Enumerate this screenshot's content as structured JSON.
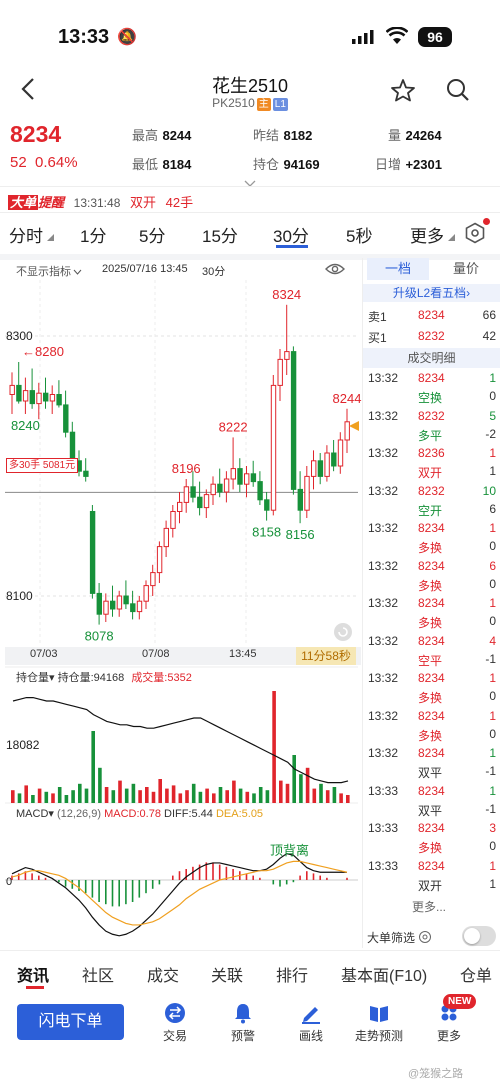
{
  "status_bar": {
    "time": "13:33",
    "battery": "96"
  },
  "header": {
    "title": "花生2510",
    "code": "PK2510",
    "tag_main": "主",
    "tag_level": "L1"
  },
  "quote": {
    "price": "8234",
    "change": "52",
    "change_pct": "0.64%",
    "high_label": "最高",
    "high": "8244",
    "low_label": "最低",
    "low": "8184",
    "prev_settle_label": "昨结",
    "prev_settle": "8182",
    "open_interest_label": "持仓",
    "open_interest": "94169",
    "volume_label": "量",
    "volume": "24264",
    "daily_add_label": "日增",
    "daily_add": "+2301"
  },
  "alert": {
    "badge_big": "大单",
    "badge_text": "提醒",
    "time": "13:31:48",
    "type": "双开",
    "lots": "42手"
  },
  "period_tabs": [
    {
      "label": "分时"
    },
    {
      "label": "1分"
    },
    {
      "label": "5分"
    },
    {
      "label": "15分"
    },
    {
      "label": "30分",
      "active": true
    },
    {
      "label": "5秒"
    },
    {
      "label": "更多"
    }
  ],
  "chart_toolbar": {
    "indicator": "不显示指标",
    "datetime": "2025/07/16 13:45",
    "period": "30分"
  },
  "chart_data": [
    {
      "type": "candlestick",
      "title": "",
      "y_ticks": [
        "8300",
        "8100"
      ],
      "x_ticks": [
        "07/03",
        "07/08",
        "13:45"
      ],
      "annotations": [
        "8324",
        "8280",
        "8240",
        "8222",
        "8196",
        "8158",
        "8156",
        "8078",
        "8244"
      ],
      "position_line_label": "多30手 5081元",
      "countdown": "11分58秒",
      "candles": [
        {
          "o": 8255,
          "h": 8272,
          "l": 8240,
          "c": 8262
        },
        {
          "o": 8262,
          "h": 8280,
          "l": 8248,
          "c": 8250
        },
        {
          "o": 8250,
          "h": 8268,
          "l": 8240,
          "c": 8258
        },
        {
          "o": 8258,
          "h": 8275,
          "l": 8244,
          "c": 8248
        },
        {
          "o": 8248,
          "h": 8264,
          "l": 8236,
          "c": 8256
        },
        {
          "o": 8256,
          "h": 8268,
          "l": 8244,
          "c": 8250
        },
        {
          "o": 8250,
          "h": 8262,
          "l": 8240,
          "c": 8255
        },
        {
          "o": 8255,
          "h": 8266,
          "l": 8245,
          "c": 8247
        },
        {
          "o": 8247,
          "h": 8258,
          "l": 8222,
          "c": 8226
        },
        {
          "o": 8226,
          "h": 8234,
          "l": 8200,
          "c": 8204
        },
        {
          "o": 8204,
          "h": 8212,
          "l": 8192,
          "c": 8196
        },
        {
          "o": 8196,
          "h": 8206,
          "l": 8188,
          "c": 8192
        },
        {
          "o": 8165,
          "h": 8170,
          "l": 8098,
          "c": 8102
        },
        {
          "o": 8102,
          "h": 8110,
          "l": 8078,
          "c": 8086
        },
        {
          "o": 8086,
          "h": 8102,
          "l": 8080,
          "c": 8096
        },
        {
          "o": 8096,
          "h": 8108,
          "l": 8084,
          "c": 8090
        },
        {
          "o": 8090,
          "h": 8104,
          "l": 8084,
          "c": 8100
        },
        {
          "o": 8100,
          "h": 8112,
          "l": 8090,
          "c": 8094
        },
        {
          "o": 8094,
          "h": 8104,
          "l": 8082,
          "c": 8088
        },
        {
          "o": 8088,
          "h": 8100,
          "l": 8082,
          "c": 8096
        },
        {
          "o": 8096,
          "h": 8112,
          "l": 8090,
          "c": 8108
        },
        {
          "o": 8108,
          "h": 8124,
          "l": 8100,
          "c": 8118
        },
        {
          "o": 8118,
          "h": 8142,
          "l": 8110,
          "c": 8138
        },
        {
          "o": 8138,
          "h": 8158,
          "l": 8130,
          "c": 8152
        },
        {
          "o": 8152,
          "h": 8170,
          "l": 8145,
          "c": 8165
        },
        {
          "o": 8165,
          "h": 8180,
          "l": 8156,
          "c": 8172
        },
        {
          "o": 8172,
          "h": 8190,
          "l": 8164,
          "c": 8184
        },
        {
          "o": 8184,
          "h": 8196,
          "l": 8172,
          "c": 8176
        },
        {
          "o": 8176,
          "h": 8188,
          "l": 8162,
          "c": 8168
        },
        {
          "o": 8168,
          "h": 8182,
          "l": 8160,
          "c": 8178
        },
        {
          "o": 8178,
          "h": 8192,
          "l": 8170,
          "c": 8186
        },
        {
          "o": 8186,
          "h": 8198,
          "l": 8176,
          "c": 8180
        },
        {
          "o": 8180,
          "h": 8196,
          "l": 8172,
          "c": 8190
        },
        {
          "o": 8190,
          "h": 8222,
          "l": 8182,
          "c": 8198
        },
        {
          "o": 8198,
          "h": 8206,
          "l": 8180,
          "c": 8186
        },
        {
          "o": 8186,
          "h": 8200,
          "l": 8176,
          "c": 8194
        },
        {
          "o": 8194,
          "h": 8204,
          "l": 8184,
          "c": 8188
        },
        {
          "o": 8188,
          "h": 8196,
          "l": 8170,
          "c": 8174
        },
        {
          "o": 8174,
          "h": 8180,
          "l": 8158,
          "c": 8166
        },
        {
          "o": 8166,
          "h": 8270,
          "l": 8162,
          "c": 8262
        },
        {
          "o": 8262,
          "h": 8290,
          "l": 8250,
          "c": 8282
        },
        {
          "o": 8282,
          "h": 8324,
          "l": 8270,
          "c": 8288
        },
        {
          "o": 8288,
          "h": 8292,
          "l": 8178,
          "c": 8182
        },
        {
          "o": 8182,
          "h": 8196,
          "l": 8156,
          "c": 8166
        },
        {
          "o": 8166,
          "h": 8200,
          "l": 8160,
          "c": 8192
        },
        {
          "o": 8192,
          "h": 8212,
          "l": 8182,
          "c": 8204
        },
        {
          "o": 8204,
          "h": 8210,
          "l": 8186,
          "c": 8192
        },
        {
          "o": 8192,
          "h": 8216,
          "l": 8188,
          "c": 8210
        },
        {
          "o": 8210,
          "h": 8220,
          "l": 8196,
          "c": 8200
        },
        {
          "o": 8200,
          "h": 8226,
          "l": 8194,
          "c": 8220
        },
        {
          "o": 8220,
          "h": 8244,
          "l": 8210,
          "c": 8234
        }
      ]
    },
    {
      "type": "bar",
      "title": "",
      "legend": [
        "持仓量▾",
        "持仓量:94168",
        "成交量:5352"
      ],
      "y_ticks": [
        "18082"
      ],
      "volume": [
        8,
        6,
        11,
        5,
        9,
        7,
        6,
        10,
        5,
        8,
        12,
        9,
        45,
        22,
        10,
        8,
        14,
        9,
        12,
        8,
        10,
        7,
        15,
        9,
        11,
        6,
        8,
        12,
        7,
        9,
        6,
        10,
        8,
        14,
        9,
        7,
        6,
        10,
        8,
        70,
        14,
        12,
        30,
        18,
        22,
        9,
        12,
        8,
        10,
        6,
        5
      ],
      "open_interest": [
        60,
        61,
        62,
        62,
        61,
        60,
        60,
        59,
        58,
        57,
        56,
        55,
        52,
        50,
        48,
        47,
        46,
        46,
        45,
        45,
        44,
        44,
        45,
        46,
        47,
        48,
        49,
        50,
        50,
        48,
        46,
        44,
        42,
        40,
        38,
        36,
        34,
        32,
        30,
        28,
        26,
        24,
        20,
        18,
        16,
        14,
        13,
        12,
        12,
        12,
        13
      ]
    },
    {
      "type": "bar",
      "title": "",
      "legend": [
        "MACD▾",
        "(12,26,9)",
        "MACD:0.78",
        "DIFF:5.44",
        "DEA:5.05"
      ],
      "y_ticks": [
        "0"
      ],
      "annotations": [
        "顶背离"
      ],
      "macd": [
        2,
        3,
        4,
        3,
        2,
        1,
        0,
        -1,
        -3,
        -4,
        -5,
        -6,
        -8,
        -10,
        -11,
        -12,
        -12,
        -11,
        -10,
        -8,
        -6,
        -4,
        -2,
        0,
        2,
        4,
        5,
        6,
        7,
        8,
        8,
        7,
        6,
        5,
        4,
        3,
        2,
        1,
        0,
        -2,
        -3,
        -2,
        -1,
        2,
        4,
        3,
        2,
        1,
        0,
        0,
        1
      ],
      "diff": [
        4,
        6,
        8,
        7,
        5,
        3,
        1,
        -2,
        -5,
        -9,
        -13,
        -18,
        -24,
        -29,
        -33,
        -35,
        -36,
        -35,
        -33,
        -30,
        -26,
        -22,
        -17,
        -12,
        -7,
        -2,
        2,
        5,
        8,
        10,
        11,
        11,
        10,
        9,
        8,
        7,
        6,
        6,
        7,
        10,
        14,
        17,
        16,
        12,
        8,
        6,
        5,
        5,
        5,
        5,
        5
      ],
      "dea": [
        2,
        3,
        5,
        6,
        6,
        5,
        4,
        3,
        1,
        -2,
        -5,
        -9,
        -13,
        -17,
        -21,
        -24,
        -26,
        -28,
        -29,
        -29,
        -28,
        -27,
        -25,
        -22,
        -19,
        -16,
        -12,
        -9,
        -6,
        -4,
        -2,
        0,
        1,
        2,
        3,
        4,
        5,
        6,
        6,
        7,
        9,
        11,
        12,
        12,
        11,
        10,
        9,
        8,
        7,
        6,
        5
      ]
    }
  ],
  "right_panel": {
    "tabs": [
      "一档",
      "量价"
    ],
    "upgrade": "升级L2看五档›",
    "ask_label": "卖1",
    "ask_price": "8234",
    "ask_vol": "66",
    "bid_label": "买1",
    "bid_price": "8232",
    "bid_vol": "42",
    "trades_title": "成交明细",
    "trades": [
      {
        "time": "13:32",
        "price": "8234",
        "vol": "1",
        "type": "空换",
        "chg": "0",
        "pcolor": "red",
        "vcolor": "green",
        "tcolor": "green"
      },
      {
        "time": "13:32",
        "price": "8232",
        "vol": "5",
        "type": "多平",
        "chg": "-2",
        "pcolor": "red",
        "vcolor": "green",
        "tcolor": "green"
      },
      {
        "time": "13:32",
        "price": "8236",
        "vol": "1",
        "type": "双开",
        "chg": "1",
        "pcolor": "red",
        "vcolor": "red",
        "tcolor": "red"
      },
      {
        "time": "13:32",
        "price": "8232",
        "vol": "10",
        "type": "空开",
        "chg": "6",
        "pcolor": "red",
        "vcolor": "green",
        "tcolor": "green"
      },
      {
        "time": "13:32",
        "price": "8234",
        "vol": "1",
        "type": "多换",
        "chg": "0",
        "pcolor": "red",
        "vcolor": "red",
        "tcolor": "red"
      },
      {
        "time": "13:32",
        "price": "8234",
        "vol": "6",
        "type": "多换",
        "chg": "0",
        "pcolor": "red",
        "vcolor": "red",
        "tcolor": "red"
      },
      {
        "time": "13:32",
        "price": "8234",
        "vol": "1",
        "type": "多换",
        "chg": "0",
        "pcolor": "red",
        "vcolor": "red",
        "tcolor": "red"
      },
      {
        "time": "13:32",
        "price": "8234",
        "vol": "4",
        "type": "空平",
        "chg": "-1",
        "pcolor": "red",
        "vcolor": "red",
        "tcolor": "red"
      },
      {
        "time": "13:32",
        "price": "8234",
        "vol": "1",
        "type": "多换",
        "chg": "0",
        "pcolor": "red",
        "vcolor": "red",
        "tcolor": "red"
      },
      {
        "time": "13:32",
        "price": "8234",
        "vol": "1",
        "type": "多换",
        "chg": "0",
        "pcolor": "red",
        "vcolor": "red",
        "tcolor": "red"
      },
      {
        "time": "13:32",
        "price": "8234",
        "vol": "1",
        "type": "双平",
        "chg": "-1",
        "pcolor": "red",
        "vcolor": "green",
        "tcolor": "#333"
      },
      {
        "time": "13:33",
        "price": "8234",
        "vol": "1",
        "type": "双平",
        "chg": "-1",
        "pcolor": "red",
        "vcolor": "green",
        "tcolor": "#333"
      },
      {
        "time": "13:33",
        "price": "8234",
        "vol": "3",
        "type": "多换",
        "chg": "0",
        "pcolor": "red",
        "vcolor": "red",
        "tcolor": "red"
      },
      {
        "time": "13:33",
        "price": "8234",
        "vol": "1",
        "type": "双开",
        "chg": "1",
        "pcolor": "red",
        "vcolor": "red",
        "tcolor": "#333"
      }
    ],
    "more": "更多...",
    "filter_label": "大单筛选"
  },
  "bottom_tabs": [
    "资讯",
    "社区",
    "成交",
    "关联",
    "排行",
    "基本面(F10)",
    "仓单"
  ],
  "bottom_bar": {
    "flash_order": "闪电下单",
    "items": [
      {
        "label": "交易",
        "icon": "trade-icon"
      },
      {
        "label": "预警",
        "icon": "bell-icon"
      },
      {
        "label": "画线",
        "icon": "pen-icon"
      },
      {
        "label": "走势预测",
        "icon": "book-icon"
      },
      {
        "label": "更多",
        "icon": "more-icon",
        "badge": "NEW"
      }
    ],
    "watermark": "@笼猴之路"
  }
}
